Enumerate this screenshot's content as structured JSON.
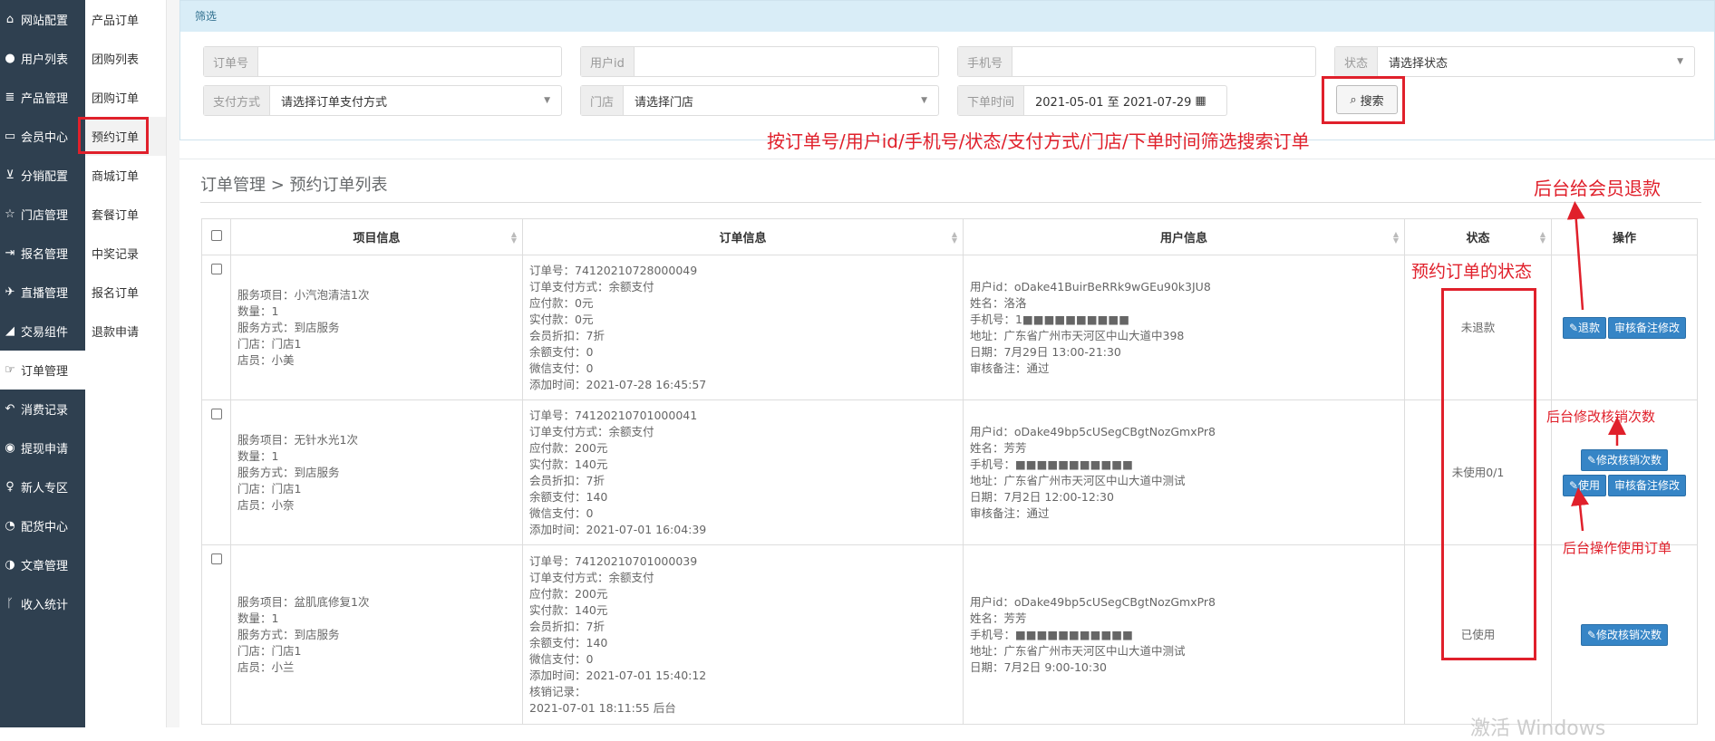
{
  "sidebar": {
    "items": [
      {
        "icon": "home-icon",
        "glyph": "⌂",
        "label": "网站配置"
      },
      {
        "icon": "user-icon",
        "glyph": "●",
        "label": "用户列表"
      },
      {
        "icon": "list-icon",
        "glyph": "≣",
        "label": "产品管理"
      },
      {
        "icon": "member-card-icon",
        "glyph": "▭",
        "label": "会员中心"
      },
      {
        "icon": "cart-icon",
        "glyph": "⊻",
        "label": "分销配置"
      },
      {
        "icon": "star-icon",
        "glyph": "☆",
        "label": "门店管理"
      },
      {
        "icon": "sign-in-icon",
        "glyph": "⇥",
        "label": "报名管理"
      },
      {
        "icon": "plane-icon",
        "glyph": "✈",
        "label": "直播管理"
      },
      {
        "icon": "eraser-icon",
        "glyph": "◢",
        "label": "交易组件"
      },
      {
        "icon": "hand-pointer-icon",
        "glyph": "☞",
        "label": "订单管理"
      },
      {
        "icon": "reply-icon",
        "glyph": "↶",
        "label": "消费记录"
      },
      {
        "icon": "wechat-icon",
        "glyph": "◉",
        "label": "提现申请"
      },
      {
        "icon": "map-marker-icon",
        "glyph": "♀",
        "label": "新人专区"
      },
      {
        "icon": "pie-chart-icon",
        "glyph": "◔",
        "label": "配货中心"
      },
      {
        "icon": "adjust-icon",
        "glyph": "◑",
        "label": "文章管理"
      },
      {
        "icon": "code-fork-icon",
        "glyph": "ᚴ",
        "label": "收入统计"
      }
    ]
  },
  "submenu": {
    "items": [
      "产品订单",
      "团购列表",
      "团购订单",
      "预约订单",
      "商城订单",
      "套餐订单",
      "中奖记录",
      "报名订单",
      "退款申请"
    ]
  },
  "filter": {
    "title": "筛选",
    "order_no_label": "订单号",
    "user_id_label": "用户id",
    "phone_label": "手机号",
    "status_label": "状态",
    "status_value": "请选择状态",
    "pay_label": "支付方式",
    "pay_value": "请选择订单支付方式",
    "store_label": "门店",
    "store_value": "请选择门店",
    "time_label": "下单时间",
    "time_value": "2021-05-01 至 2021-07-29",
    "search_label": "搜索"
  },
  "annotations": {
    "filter_note": "按订单号/用户id/手机号/状态/支付方式/门店/下单时间筛选搜索订单",
    "refund_note": "后台给会员退款",
    "status_note": "预约订单的状态",
    "modify_note": "后台修改核销次数",
    "use_note": "后台操作使用订单"
  },
  "list": {
    "title": "订单管理 > 预约订单列表",
    "headers": [
      "项目信息",
      "订单信息",
      "用户信息",
      "状态",
      "操作"
    ]
  },
  "rows": [
    {
      "project": [
        "服务项目：小汽泡清洁1次",
        "数量：1",
        "服务方式：到店服务",
        "门店：门店1",
        "店员：小美"
      ],
      "order": [
        "订单号：74120210728000049",
        "订单支付方式：余额支付",
        "应付款：0元",
        "实付款：0元",
        "会员折扣：7折",
        "余额支付：0",
        "微信支付：0",
        "添加时间：2021-07-28 16:45:57"
      ],
      "user": [
        "用户id：oDake41BuirBeRRk9wGEu90k3JU8",
        "姓名：洛洛",
        "手机号：1■■■■■■■■■■",
        "地址：广东省广州市天河区中山大道中398",
        "日期：7月29日 13:00-21:30",
        "审核备注：通过"
      ],
      "status": "未退款",
      "buttons": [
        {
          "label": "退款",
          "icon": "✎"
        },
        {
          "label": "审核备注修改",
          "icon": ""
        }
      ]
    },
    {
      "project": [
        "服务项目：无针水光1次",
        "数量：1",
        "服务方式：到店服务",
        "门店：门店1",
        "店员：小奈"
      ],
      "order": [
        "订单号：74120210701000041",
        "订单支付方式：余额支付",
        "应付款：200元",
        "实付款：140元",
        "会员折扣：7折",
        "余额支付：140",
        "微信支付：0",
        "添加时间：2021-07-01 16:04:39"
      ],
      "user": [
        "用户id：oDake49bp5cUSegCBgtNozGmxPr8",
        "姓名：芳芳",
        "手机号：■■■■■■■■■■■",
        "地址：广东省广州市天河区中山大道中测试",
        "日期：7月2日 12:00-12:30",
        "审核备注：通过"
      ],
      "status": "未使用0/1",
      "buttons": [
        {
          "label": "修改核销次数",
          "icon": "✎"
        },
        {
          "label": "使用",
          "icon": "✎"
        },
        {
          "label": "审核备注修改",
          "icon": ""
        }
      ]
    },
    {
      "project": [
        "服务项目：盆肌底修复1次",
        "数量：1",
        "服务方式：到店服务",
        "门店：门店1",
        "店员：小兰"
      ],
      "order": [
        "订单号：74120210701000039",
        "订单支付方式：余额支付",
        "应付款：200元",
        "实付款：140元",
        "会员折扣：7折",
        "余额支付：140",
        "微信支付：0",
        "添加时间：2021-07-01 15:40:12",
        "核销记录：",
        "2021-07-01 18:11:55 后台"
      ],
      "user": [
        "用户id：oDake49bp5cUSegCBgtNozGmxPr8",
        "姓名：芳芳",
        "手机号：■■■■■■■■■■■",
        "地址：广东省广州市天河区中山大道中测试",
        "日期：7月2日 9:00-10:30"
      ],
      "status": "已使用",
      "buttons": [
        {
          "label": "修改核销次数",
          "icon": "✎"
        }
      ]
    }
  ],
  "watermark": "激活 Windows"
}
